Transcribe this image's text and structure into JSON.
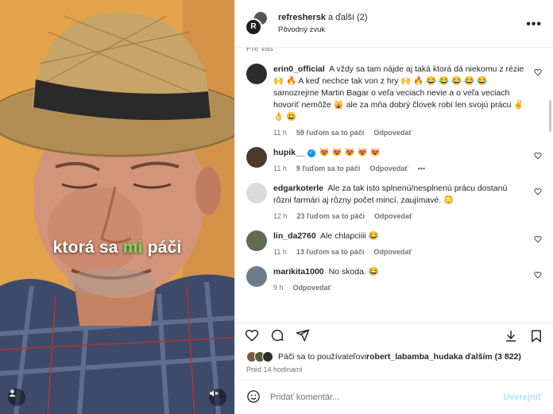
{
  "video": {
    "caption_prefix": "ktorá sa ",
    "caption_highlight": "mi",
    "caption_suffix": " páči"
  },
  "header": {
    "title_user": "refreshersk",
    "title_rest": " a ďalší (2)",
    "subtitle": "Pôvodný zvuk",
    "brand_badge": "R",
    "more_label": "•••"
  },
  "comments": {
    "for_you_label": "Pre vás",
    "items": [
      {
        "user": "erin0_official",
        "text": "A vždy sa tam nájde aj taká ktorá dá niekomu z rézie 🙌 🔥 A keď nechce tak von z hry 🙌 🔥 😂 😂 😂 😂 😂 samozrejme Martin Bagar o veľa veciach nevie a o veľa veciach hovoriť nemôže 🙀 ale za mňa dobrý človek robí len svojú prácu ✌️ 👌 😃",
        "time": "11 h",
        "likes": "59 ľuďom sa to páči",
        "reply": "Odpovedať",
        "avatar_color": "#2b2b2b"
      },
      {
        "user": "hupik__",
        "verified": true,
        "text": "😻 😻 😻 😻 😻",
        "time": "11 h",
        "likes": "9 ľuďom sa to páči",
        "reply": "Odpovedať",
        "extra": "•••",
        "avatar_color": "#4a3b2e"
      },
      {
        "user": "edgarkoterle",
        "text": "Ale za tak isto splnenú/nesplnenú prácu dostanú rôzni farmári aj rôzny počet mincí, zaujímavé. 😳",
        "time": "12 h",
        "likes": "23 ľuďom sa to páči",
        "reply": "Odpovedať",
        "avatar_color": "#dbdbdb"
      },
      {
        "user": "lin_da2760",
        "text": "Ale chlapciiii 😂",
        "time": "11 h",
        "likes": "13 ľuďom sa to páči",
        "reply": "Odpovedať",
        "avatar_color": "#5d6b57"
      },
      {
        "user": "marikita1000",
        "text": "No skoda. 😂",
        "time": "9 h",
        "reply": "Odpovedať",
        "avatar_color": "#6b7d8c"
      }
    ]
  },
  "likes_line": {
    "prefix": "Páči sa to používateľovi ",
    "user": "robert_labamba_hudak",
    "suffix": " a ďalším (3 822)"
  },
  "posted": "Pred 14 hodinami",
  "add_comment": {
    "placeholder": "Pridať komentár...",
    "post_label": "Uverejniť"
  },
  "colors": {
    "accent": "#0095f6",
    "caption_highlight": "#6fe35a",
    "muted": "#737373"
  }
}
